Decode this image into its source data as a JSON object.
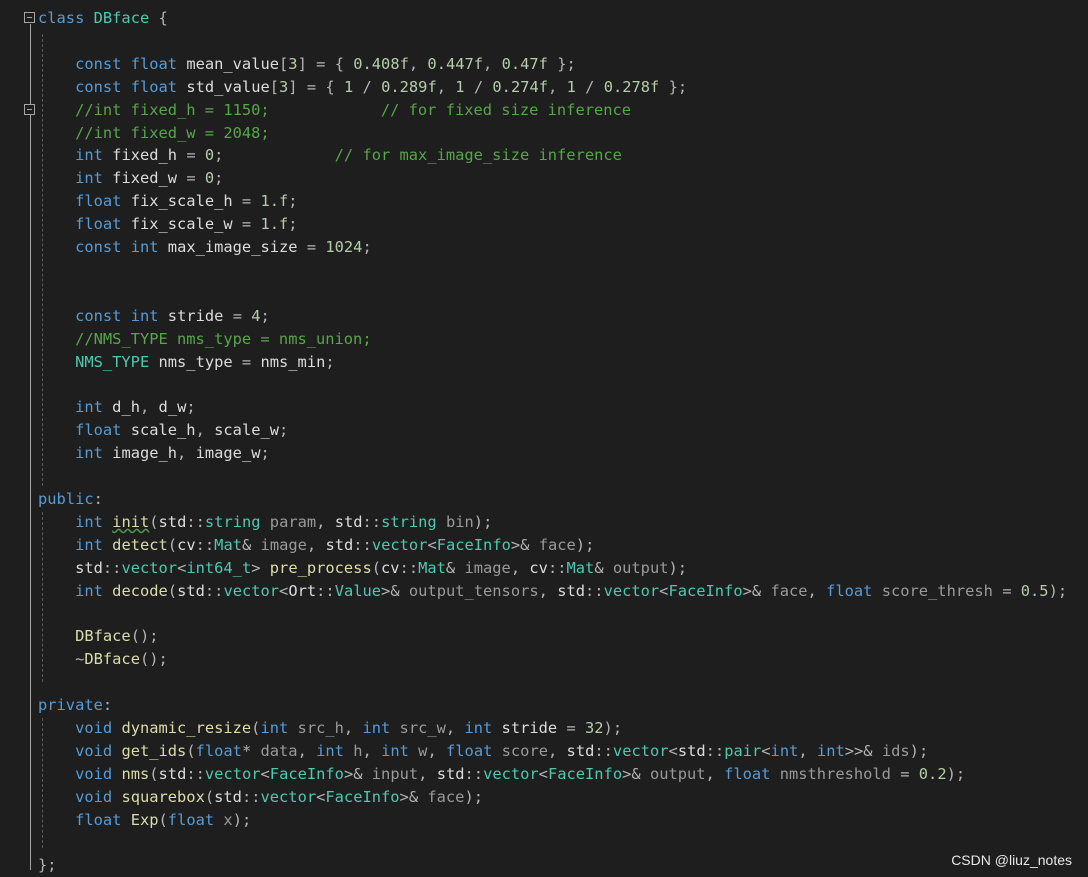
{
  "watermark": "CSDN @liuz_notes",
  "code_lines": [
    "class DBface {",
    "",
    "    const float mean_value[3] = { 0.408f, 0.447f, 0.47f };",
    "    const float std_value[3] = { 1 / 0.289f, 1 / 0.274f, 1 / 0.278f };",
    "    //int fixed_h = 1150;            // for fixed size inference",
    "    //int fixed_w = 2048;",
    "    int fixed_h = 0;            // for max_image_size inference",
    "    int fixed_w = 0;",
    "    float fix_scale_h = 1.f;",
    "    float fix_scale_w = 1.f;",
    "    const int max_image_size = 1024;",
    "",
    "",
    "    const int stride = 4;",
    "    //NMS_TYPE nms_type = nms_union;",
    "    NMS_TYPE nms_type = nms_min;",
    "",
    "    int d_h, d_w;",
    "    float scale_h, scale_w;",
    "    int image_h, image_w;",
    "",
    "public:",
    "    int init(std::string param, std::string bin);",
    "    int detect(cv::Mat& image, std::vector<FaceInfo>& face);",
    "    std::vector<int64_t> pre_process(cv::Mat& image, cv::Mat& output);",
    "    int decode(std::vector<Ort::Value>& output_tensors, std::vector<FaceInfo>& face, float score_thresh = 0.5);",
    "",
    "    DBface();",
    "    ~DBface();",
    "",
    "private:",
    "    void dynamic_resize(int src_h, int src_w, int stride = 32);",
    "    void get_ids(float* data, int h, int w, float score, std::vector<std::pair<int, int>>& ids);",
    "    void nms(std::vector<FaceInfo>& input, std::vector<FaceInfo>& output, float nmsthreshold = 0.2);",
    "    void squarebox(std::vector<FaceInfo>& face);",
    "    float Exp(float x);",
    "",
    "};"
  ],
  "fold_markers": [
    "class-fold-icon",
    "comment-fold-icon"
  ],
  "squiggle_word": "init",
  "colors": {
    "background": "#1e1e1e",
    "keyword": "#569cd6",
    "type": "#4ec9b0",
    "function": "#dcdcaa",
    "number": "#b5cea8",
    "comment": "#57a64a",
    "identifier": "#dcdcdc",
    "parameter": "#9a9a9a"
  }
}
